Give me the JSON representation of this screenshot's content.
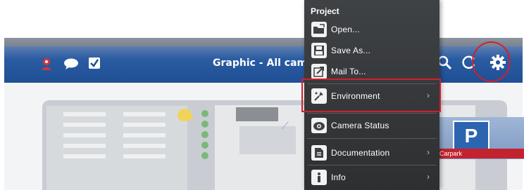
{
  "toolbar": {
    "title": "Graphic - All came",
    "icons": [
      "user-icon",
      "chat-icon",
      "check-icon",
      "search-icon",
      "refresh-icon",
      "gear-icon"
    ]
  },
  "background": {
    "carpark_label": "Carpark",
    "parking_sign": "P"
  },
  "menu": {
    "heading": "Project",
    "items": [
      {
        "label": "Open...",
        "icon": "folder-open-icon",
        "submenu": false
      },
      {
        "label": "Save As...",
        "icon": "save-icon",
        "submenu": false
      },
      {
        "label": "Mail To...",
        "icon": "mail-to-icon",
        "submenu": false
      },
      {
        "label": "Environment",
        "icon": "environment-icon",
        "submenu": true
      },
      {
        "label": "Camera Status",
        "icon": "camera-status-icon",
        "submenu": false
      },
      {
        "label": "Documentation",
        "icon": "documentation-icon",
        "submenu": true
      },
      {
        "label": "Info",
        "icon": "info-icon",
        "submenu": true
      }
    ]
  },
  "colors": {
    "toolbar_blue": "#2a5ca2",
    "menu_background": "#2d2f31",
    "highlight_red": "#d1202c"
  }
}
